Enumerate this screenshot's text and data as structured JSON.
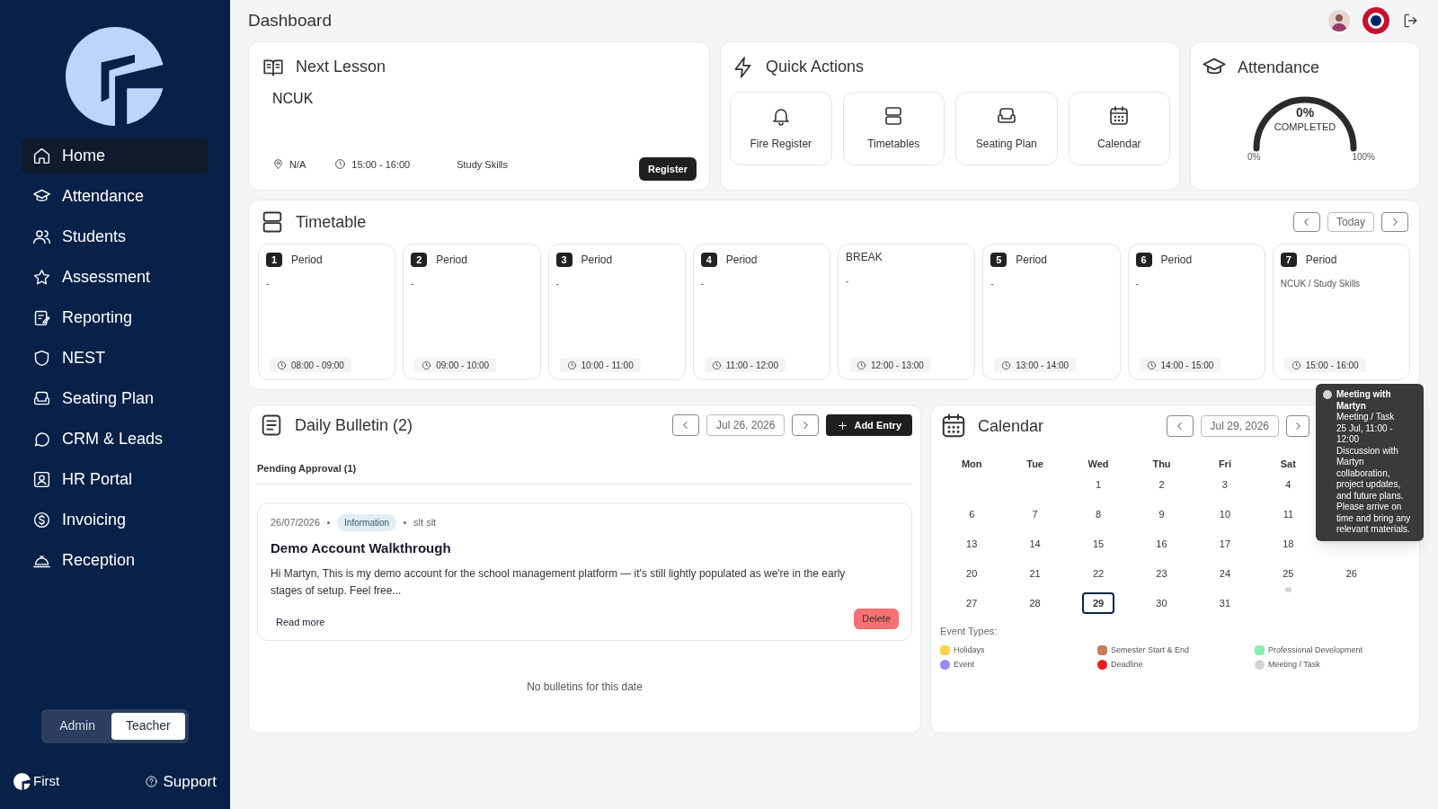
{
  "sidebar": {
    "brand": "First",
    "nav": [
      {
        "label": "Home",
        "selected": true
      },
      {
        "label": "Attendance",
        "selected": false
      },
      {
        "label": "Students",
        "selected": false
      },
      {
        "label": "Assessment",
        "selected": false
      },
      {
        "label": "Reporting",
        "selected": false
      },
      {
        "label": "NEST",
        "selected": false
      },
      {
        "label": "Seating Plan",
        "selected": false
      },
      {
        "label": "CRM & Leads",
        "selected": false
      },
      {
        "label": "HR Portal",
        "selected": false
      },
      {
        "label": "Invoicing",
        "selected": false
      },
      {
        "label": "Reception",
        "selected": false
      }
    ],
    "roles": [
      {
        "label": "Admin",
        "selected": false
      },
      {
        "label": "Teacher",
        "selected": true
      }
    ],
    "support": "Support"
  },
  "header": {
    "title": "Dashboard"
  },
  "next_lesson": {
    "title": "Next Lesson",
    "class_name": "NCUK",
    "location": "N/A",
    "time": "15:00 - 16:00",
    "subject": "Study Skills",
    "button": "Register"
  },
  "quick_actions": {
    "title": "Quick Actions",
    "items": [
      {
        "label": "Fire Register"
      },
      {
        "label": "Timetables"
      },
      {
        "label": "Seating Plan"
      },
      {
        "label": "Calendar"
      }
    ]
  },
  "attendance": {
    "title": "Attendance",
    "value": "0%",
    "caption": "COMPLETED",
    "min": "0%",
    "max": "100%"
  },
  "timetable": {
    "title": "Timetable",
    "today": "Today",
    "periods": [
      {
        "kind": "period",
        "number": "1",
        "label": "Period",
        "detail": "-",
        "time": "08:00 - 09:00"
      },
      {
        "kind": "period",
        "number": "2",
        "label": "Period",
        "detail": "-",
        "time": "09:00 - 10:00"
      },
      {
        "kind": "period",
        "number": "3",
        "label": "Period",
        "detail": "-",
        "time": "10:00 - 11:00"
      },
      {
        "kind": "period",
        "number": "4",
        "label": "Period",
        "detail": "-",
        "time": "11:00 - 12:00"
      },
      {
        "kind": "break",
        "label": "BREAK",
        "detail": "-",
        "time": "12:00 - 13:00"
      },
      {
        "kind": "period",
        "number": "5",
        "label": "Period",
        "detail": "-",
        "time": "13:00 - 14:00"
      },
      {
        "kind": "period",
        "number": "6",
        "label": "Period",
        "detail": "-",
        "time": "14:00 - 15:00"
      },
      {
        "kind": "period",
        "number": "7",
        "label": "Period",
        "detail": "NCUK / Study Skills",
        "time": "15:00 - 16:00"
      }
    ]
  },
  "bulletin": {
    "title": "Daily Bulletin (2)",
    "date": "Jul 26, 2026",
    "add_button": "Add Entry",
    "section": "Pending Approval (1)",
    "entries": [
      {
        "date": "26/07/2026",
        "tag": "Information",
        "author": "slt slt",
        "title": "Demo Account Walkthrough",
        "body": "Hi Martyn, This is my demo account for the school management platform — it's still lightly populated as we're in the early stages of setup. Feel free...",
        "read_more": "Read more",
        "delete_button": "Delete"
      }
    ],
    "empty": "No bulletins for this date"
  },
  "calendar": {
    "title": "Calendar",
    "date": "Jul 29, 2026",
    "weekdays": [
      "Mon",
      "Tue",
      "Wed",
      "Thu",
      "Fri",
      "Sat"
    ],
    "weeks": [
      [
        {
          "kind": "blank"
        },
        {
          "kind": "blank"
        },
        {
          "kind": "day",
          "day": "1",
          "selected": false
        },
        {
          "kind": "day",
          "day": "2",
          "selected": false
        },
        {
          "kind": "day",
          "day": "3",
          "selected": false
        },
        {
          "kind": "day",
          "day": "4",
          "selected": false
        },
        {
          "kind": "blank"
        }
      ],
      [
        {
          "kind": "day",
          "day": "6",
          "selected": false
        },
        {
          "kind": "day",
          "day": "7",
          "selected": false
        },
        {
          "kind": "day",
          "day": "8",
          "selected": false
        },
        {
          "kind": "day",
          "day": "9",
          "selected": false
        },
        {
          "kind": "day",
          "day": "10",
          "selected": false
        },
        {
          "kind": "day",
          "day": "11",
          "selected": false
        },
        {
          "kind": "blank"
        }
      ],
      [
        {
          "kind": "day",
          "day": "13",
          "selected": false
        },
        {
          "kind": "day",
          "day": "14",
          "selected": false
        },
        {
          "kind": "day",
          "day": "15",
          "selected": false
        },
        {
          "kind": "day",
          "day": "16",
          "selected": false
        },
        {
          "kind": "day",
          "day": "17",
          "selected": false
        },
        {
          "kind": "day",
          "day": "18",
          "selected": false
        },
        {
          "kind": "blank"
        }
      ],
      [
        {
          "kind": "day",
          "day": "20",
          "selected": false
        },
        {
          "kind": "day",
          "day": "21",
          "selected": false
        },
        {
          "kind": "day",
          "day": "22",
          "selected": false
        },
        {
          "kind": "day",
          "day": "23",
          "selected": false
        },
        {
          "kind": "day",
          "day": "24",
          "selected": false
        },
        {
          "kind": "day",
          "day": "25",
          "selected": false,
          "events": [
            {
              "color": "#d4d4d4"
            }
          ]
        },
        {
          "kind": "day",
          "day": "26",
          "selected": false
        }
      ],
      [
        {
          "kind": "day",
          "day": "27",
          "selected": false
        },
        {
          "kind": "day",
          "day": "28",
          "selected": false
        },
        {
          "kind": "day",
          "day": "29",
          "selected": true
        },
        {
          "kind": "day",
          "day": "30",
          "selected": false
        },
        {
          "kind": "day",
          "day": "31",
          "selected": false
        },
        {
          "kind": "blank"
        },
        {
          "kind": "blank"
        }
      ]
    ],
    "legend_title": "Event Types:",
    "legend": [
      {
        "label": "Holidays",
        "color": "#fcd34d"
      },
      {
        "label": "Semester Start & End",
        "color": "#c97a5c"
      },
      {
        "label": "Professional Development",
        "color": "#86efac"
      },
      {
        "label": "Event",
        "color": "#9b87f5"
      },
      {
        "label": "Deadline",
        "color": "#ef1c1c"
      },
      {
        "label": "Meeting / Task",
        "color": "#d4d4d4"
      }
    ],
    "tooltip": {
      "title": "Meeting with Martyn",
      "type": "Meeting / Task",
      "when": "25 Jul, 11:00 - 12:00",
      "description": "Discussion with Martyn collaboration, project updates, and future plans. Please arrive on time and bring any relevant materials.",
      "color": "#d4d4d4"
    }
  }
}
